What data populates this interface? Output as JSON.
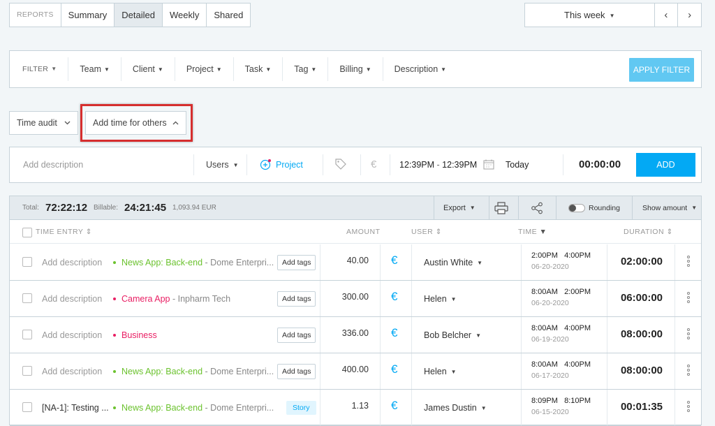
{
  "tabs": {
    "reports": "REPORTS",
    "summary": "Summary",
    "detailed": "Detailed",
    "weekly": "Weekly",
    "shared": "Shared"
  },
  "daterange": {
    "label": "This week",
    "prev": "‹",
    "next": "›"
  },
  "filters": {
    "filter": "FILTER",
    "team": "Team",
    "client": "Client",
    "project": "Project",
    "task": "Task",
    "tag": "Tag",
    "billing": "Billing",
    "description": "Description",
    "apply": "APPLY FILTER"
  },
  "time_audit": "Time audit",
  "add_time_others": "Add time for others",
  "entry": {
    "description_placeholder": "Add description",
    "users": "Users",
    "project": "Project",
    "time_start": "12:39PM",
    "time_dash": "-",
    "time_end": "12:39PM",
    "date": "Today",
    "duration": "00:00:00",
    "add": "ADD"
  },
  "totals": {
    "total_label": "Total:",
    "total": "72:22:12",
    "billable_label": "Billable:",
    "billable": "24:21:45",
    "amount": "1,093.94 EUR",
    "export": "Export",
    "rounding": "Rounding",
    "show_amount": "Show amount"
  },
  "columns": {
    "time_entry": "TIME ENTRY",
    "amount": "AMOUNT",
    "user": "USER",
    "time": "TIME",
    "duration": "DURATION"
  },
  "rows": [
    {
      "description": "Add description",
      "project": "News App: Back-end",
      "project_color": "#6bc22e",
      "client": "- Dome Enterpri...",
      "tag": "Add tags",
      "amount": "40.00",
      "user": "Austin White",
      "start": "2:00PM",
      "end": "4:00PM",
      "date": "06-20-2020",
      "duration": "02:00:00"
    },
    {
      "description": "Add description",
      "project": "Camera App",
      "project_color": "#e91e63",
      "client": "- Inpharm Tech",
      "tag": "Add tags",
      "amount": "300.00",
      "user": "Helen",
      "start": "8:00AM",
      "end": "2:00PM",
      "date": "06-20-2020",
      "duration": "06:00:00"
    },
    {
      "description": "Add description",
      "project": "Business",
      "project_color": "#e91e63",
      "client": "",
      "tag": "Add tags",
      "amount": "336.00",
      "user": "Bob Belcher",
      "start": "8:00AM",
      "end": "4:00PM",
      "date": "06-19-2020",
      "duration": "08:00:00"
    },
    {
      "description": "Add description",
      "project": "News App: Back-end",
      "project_color": "#6bc22e",
      "client": "- Dome Enterpri...",
      "tag": "Add tags",
      "amount": "400.00",
      "user": "Helen",
      "start": "8:00AM",
      "end": "4:00PM",
      "date": "06-17-2020",
      "duration": "08:00:00"
    },
    {
      "description": "[NA-1]: Testing ...",
      "project": "News App: Back-end",
      "project_color": "#6bc22e",
      "client": "- Dome Enterpri...",
      "tag": "Story",
      "amount": "1.13",
      "user": "James Dustin",
      "start": "8:09PM",
      "end": "8:10PM",
      "date": "06-15-2020",
      "duration": "00:01:35"
    }
  ],
  "euro_symbol": "€"
}
